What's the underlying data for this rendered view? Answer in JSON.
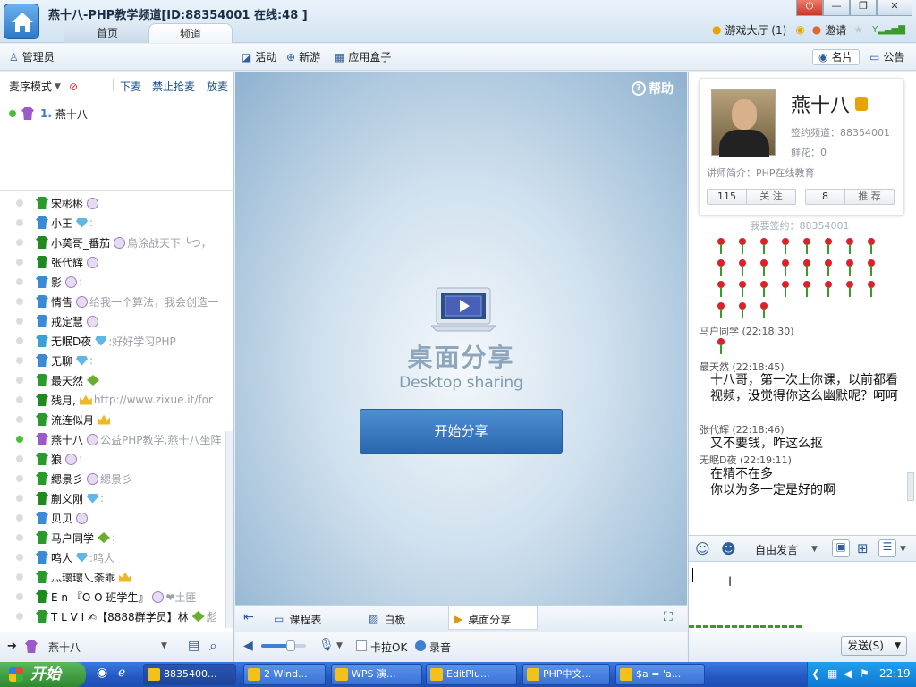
{
  "window": {
    "title": "燕十八-PHP教学频道[ID:88354001 在线:48 ]",
    "tabs": [
      "首页",
      "频道"
    ],
    "top_right": {
      "lobby": "游戏大厅 (1)",
      "invite": "邀请"
    }
  },
  "toolbar": {
    "admin": "管理员",
    "activity": "活动",
    "new_game": "新游",
    "app_box": "应用盒子",
    "card": "名片",
    "notice": "公告"
  },
  "left": {
    "mode": "麦序模式",
    "down_mic": "下麦",
    "no_grab": "禁止抢麦",
    "release": "放麦",
    "queue": [
      {
        "index": "1.",
        "name": "燕十八"
      }
    ],
    "users": [
      {
        "name": "宋彬彬",
        "msg": ""
      },
      {
        "name": "小王",
        "msg": ":"
      },
      {
        "name": "小䶮哥_番茄",
        "msg": "鳥涂战天下 ╰つ，"
      },
      {
        "name": "张代辉",
        "msg": ""
      },
      {
        "name": "影",
        "msg": ":"
      },
      {
        "name": "情售",
        "msg": "给我一个算法，我会创造一"
      },
      {
        "name": "戒定慧",
        "msg": ""
      },
      {
        "name": "无眠D夜",
        "msg": ":好好学习PHP"
      },
      {
        "name": "无聊",
        "msg": ":"
      },
      {
        "name": "最天然",
        "msg": ""
      },
      {
        "name": "残月,",
        "msg": "http://www.zixue.it/for"
      },
      {
        "name": "流连似月",
        "msg": ""
      },
      {
        "name": "燕十八",
        "msg": "公益PHP教学,燕十八坐阵"
      },
      {
        "name": "狼",
        "msg": ":"
      },
      {
        "name": "緦景彡",
        "msg": "緦景彡"
      },
      {
        "name": "蒯义刚",
        "msg": ":"
      },
      {
        "name": "贝贝",
        "msg": ""
      },
      {
        "name": "马户同学",
        "msg": ":"
      },
      {
        "name": "鸣人",
        "msg": ":鸣人"
      },
      {
        "name": "灬瓌瓌乀荼乖",
        "msg": ""
      },
      {
        "name": "E n 『O O 班学生』",
        "msg": "❤土匪"
      },
      {
        "name": "T L V I ✍【8888群学员】林",
        "msg": "彪"
      }
    ],
    "bottom_user": "燕十八"
  },
  "center": {
    "help": "帮助",
    "title_cn": "桌面分享",
    "title_en": "Desktop sharing",
    "start_button": "开始分享",
    "tabs": [
      "课程表",
      "白板",
      "桌面分享"
    ],
    "karaoke": "卡拉OK",
    "record": "录音"
  },
  "right": {
    "teacher_name": "燕十八",
    "sign_channel": "签约频道：88354001",
    "flowers": "鲜花：0",
    "intro": "讲师简介：PHP在线教育",
    "follow_count": "115",
    "follow_label": "关 注",
    "recommend_count": "8",
    "recommend_label": "推 荐",
    "sign_link": "我要签约：88354001",
    "messages": [
      {
        "name": "马户同学",
        "time": "(22:18:30)",
        "text": ""
      },
      {
        "name": "最天然",
        "time": "(22:18:45)",
        "text": "十八哥，第一次上你课，以前都看视频，没觉得你这么幽默呢？呵呵"
      },
      {
        "name": "张代辉",
        "time": "(22:18:46)",
        "text": "又不要钱，咋这么抠"
      },
      {
        "name": "无眠D夜",
        "time": "(22:19:11)",
        "text": "在精不在多"
      },
      {
        "name": "",
        "time": "",
        "text": "你以为多一定是好的啊"
      }
    ],
    "speech_mode": "自由发言",
    "send": "发送(S)"
  },
  "taskbar": {
    "start": "开始",
    "items": [
      "8835400...",
      "2 Wind...",
      "WPS 演...",
      "EditPlu...",
      "PHP中文...",
      "$a = 'a..."
    ],
    "clock": "22:19"
  },
  "colors": {
    "accent": "#2e79c9",
    "start_green": "#2f8a2f",
    "taskbar": "#2458c2"
  }
}
